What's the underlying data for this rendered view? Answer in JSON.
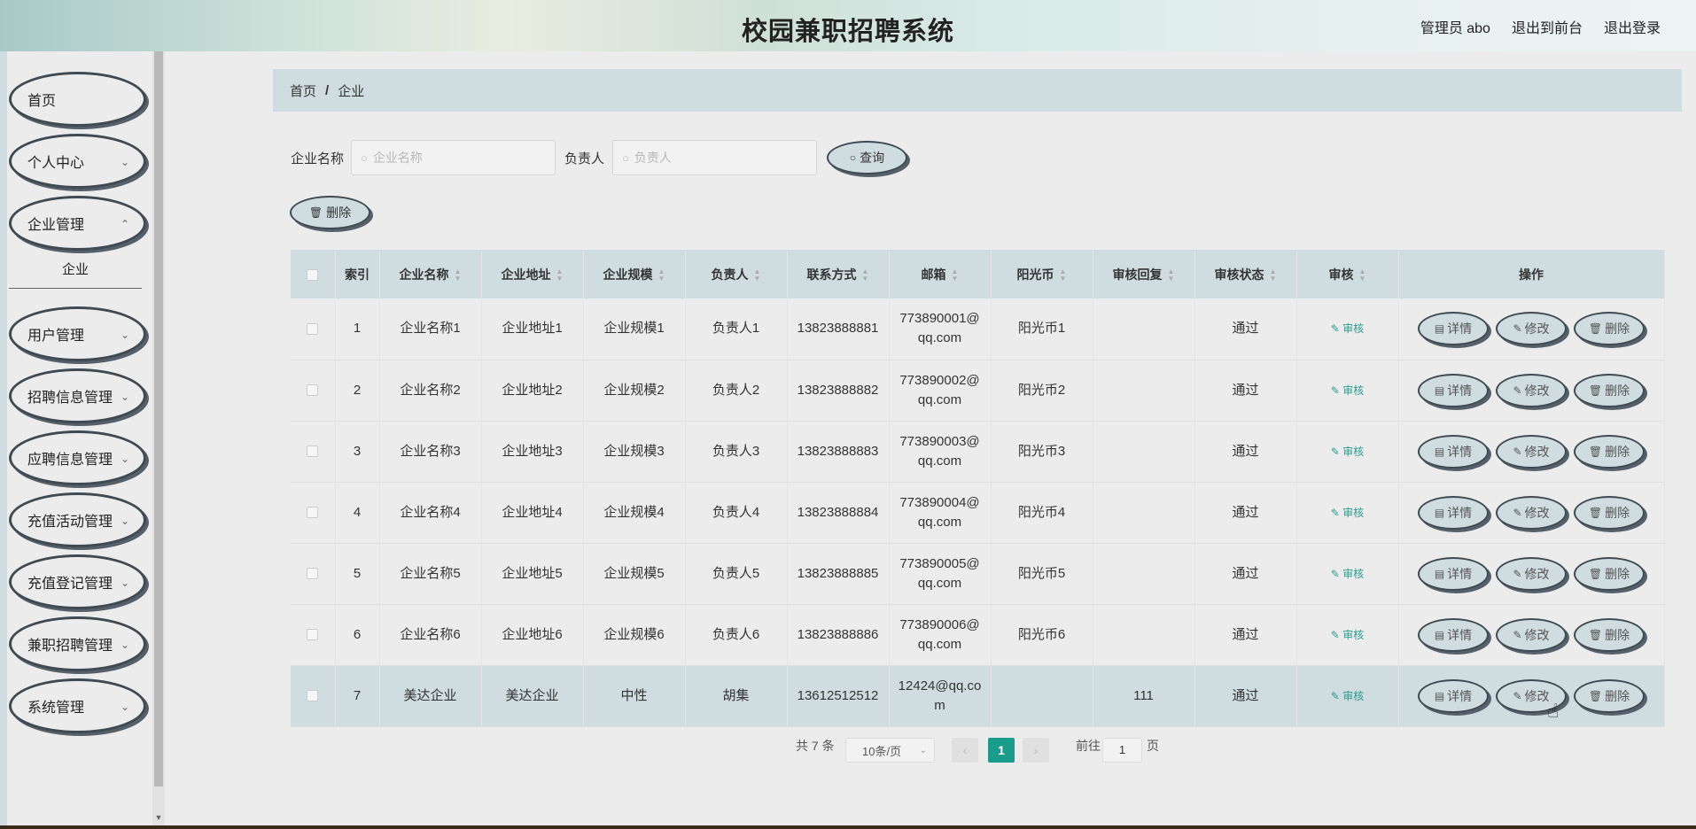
{
  "header": {
    "title": "校园兼职招聘系统",
    "admin": "管理员 abo",
    "to_front": "退出到前台",
    "logout": "退出登录"
  },
  "sidebar": {
    "items": [
      {
        "label": "首页"
      },
      {
        "label": "个人中心"
      },
      {
        "label": "企业管理"
      },
      {
        "label": "用户管理"
      },
      {
        "label": "招聘信息管理"
      },
      {
        "label": "应聘信息管理"
      },
      {
        "label": "充值活动管理"
      },
      {
        "label": "充值登记管理"
      },
      {
        "label": "兼职招聘管理"
      },
      {
        "label": "系统管理"
      }
    ],
    "submenu": "企业"
  },
  "breadcrumb": {
    "home": "首页",
    "sep": "/",
    "current": "企业"
  },
  "search": {
    "name_label": "企业名称",
    "name_placeholder": "企业名称",
    "person_label": "负责人",
    "person_placeholder": "负责人",
    "query_label": "查询"
  },
  "toolbar": {
    "delete_label": "删除"
  },
  "table": {
    "columns": [
      "索引",
      "企业名称",
      "企业地址",
      "企业规模",
      "负责人",
      "联系方式",
      "邮箱",
      "阳光币",
      "审核回复",
      "审核状态",
      "审核",
      "操作"
    ],
    "audit_label": "审核",
    "detail_label": "详情",
    "edit_label": "修改",
    "delete_label": "删除",
    "rows": [
      {
        "idx": "1",
        "name": "企业名称1",
        "addr": "企业地址1",
        "scale": "企业规模1",
        "person": "负责人1",
        "phone": "13823888881",
        "email1": "773890001@",
        "email2": "qq.com",
        "coin": "阳光币1",
        "reply": "",
        "status": "通过"
      },
      {
        "idx": "2",
        "name": "企业名称2",
        "addr": "企业地址2",
        "scale": "企业规模2",
        "person": "负责人2",
        "phone": "13823888882",
        "email1": "773890002@",
        "email2": "qq.com",
        "coin": "阳光币2",
        "reply": "",
        "status": "通过"
      },
      {
        "idx": "3",
        "name": "企业名称3",
        "addr": "企业地址3",
        "scale": "企业规模3",
        "person": "负责人3",
        "phone": "13823888883",
        "email1": "773890003@",
        "email2": "qq.com",
        "coin": "阳光币3",
        "reply": "",
        "status": "通过"
      },
      {
        "idx": "4",
        "name": "企业名称4",
        "addr": "企业地址4",
        "scale": "企业规模4",
        "person": "负责人4",
        "phone": "13823888884",
        "email1": "773890004@",
        "email2": "qq.com",
        "coin": "阳光币4",
        "reply": "",
        "status": "通过"
      },
      {
        "idx": "5",
        "name": "企业名称5",
        "addr": "企业地址5",
        "scale": "企业规模5",
        "person": "负责人5",
        "phone": "13823888885",
        "email1": "773890005@",
        "email2": "qq.com",
        "coin": "阳光币5",
        "reply": "",
        "status": "通过"
      },
      {
        "idx": "6",
        "name": "企业名称6",
        "addr": "企业地址6",
        "scale": "企业规模6",
        "person": "负责人6",
        "phone": "13823888886",
        "email1": "773890006@",
        "email2": "qq.com",
        "coin": "阳光币6",
        "reply": "",
        "status": "通过"
      },
      {
        "idx": "7",
        "name": "美达企业",
        "addr": "美达企业",
        "scale": "中性",
        "person": "胡集",
        "phone": "13612512512",
        "email1": "12424@qq.co",
        "email2": "m",
        "coin": "",
        "reply": "111",
        "status": "通过"
      }
    ]
  },
  "pagination": {
    "total": "共 7 条",
    "size": "10条/页",
    "current": "1",
    "goto_label": "前往",
    "goto_value": "1",
    "page_suffix": "页"
  }
}
